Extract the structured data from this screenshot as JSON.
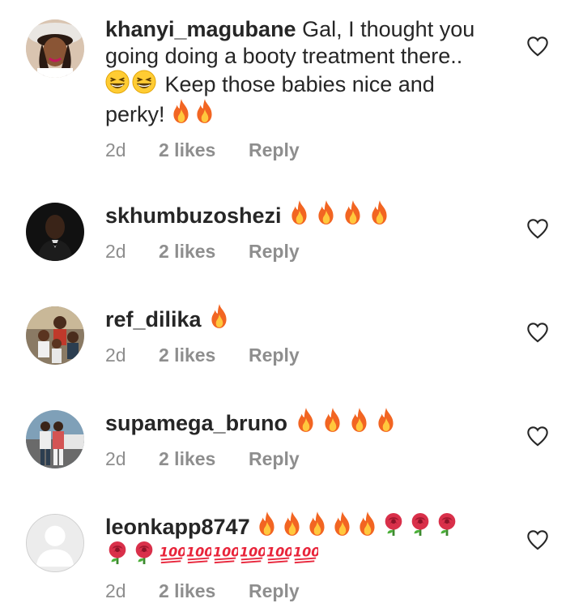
{
  "comments": [
    {
      "username": "khanyi_magubane",
      "lines": [
        "Gal, I thought you",
        "going doing a booty treatment there..",
        "Keep those babies nice and",
        "perky!"
      ],
      "time": "2d",
      "likes": "2 likes",
      "reply": "Reply"
    },
    {
      "username": "skhumbuzoshezi",
      "time": "2d",
      "likes": "2 likes",
      "reply": "Reply"
    },
    {
      "username": "ref_dilika",
      "time": "2d",
      "likes": "2 likes",
      "reply": "Reply"
    },
    {
      "username": "supamega_bruno",
      "time": "2d",
      "likes": "2 likes",
      "reply": "Reply"
    },
    {
      "username": "leonkapp8747",
      "time": "2d",
      "likes": "2 likes",
      "reply": "Reply"
    }
  ],
  "icons": {
    "like": "heart-outline-icon",
    "fire": "fire-emoji",
    "laugh": "grinning-squinting-face-emoji",
    "rose": "rose-emoji",
    "hundred": "hundred-points-emoji"
  },
  "colors": {
    "text": "#262626",
    "meta": "#8e8e8e",
    "heart": "#262626"
  }
}
